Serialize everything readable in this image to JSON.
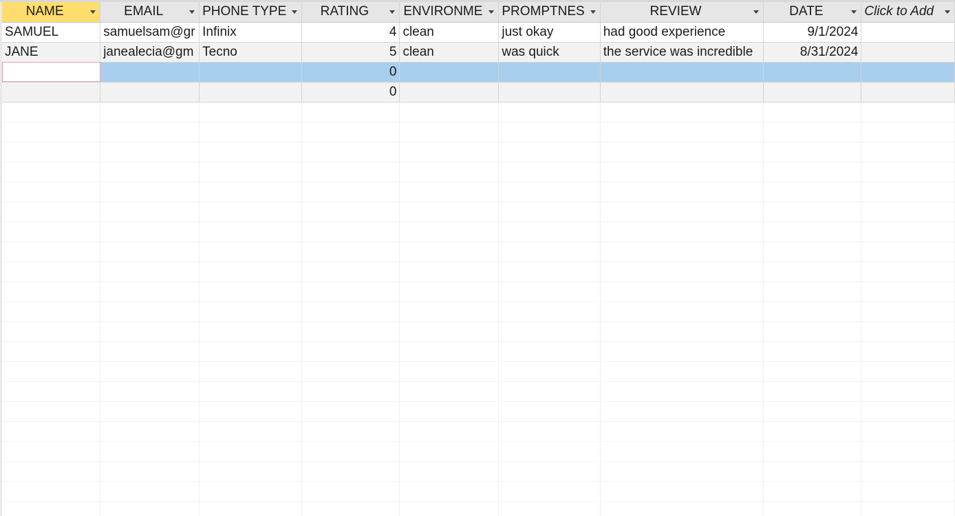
{
  "columns": [
    {
      "label": "NAME"
    },
    {
      "label": "EMAIL"
    },
    {
      "label": "PHONE TYPE"
    },
    {
      "label": "RATING"
    },
    {
      "label": "ENVIRONME"
    },
    {
      "label": "PROMPTNES"
    },
    {
      "label": "REVIEW"
    },
    {
      "label": "DATE"
    },
    {
      "label": "Click to Add"
    }
  ],
  "rows": [
    {
      "name": "SAMUEL",
      "email": "samuelsam@gr",
      "phone_type": "Infinix",
      "rating": "4",
      "environment": "clean",
      "promptness": "just okay",
      "review": "had good experience",
      "date": "9/1/2024",
      "extra": ""
    },
    {
      "name": "JANE",
      "email": "janealecia@gm",
      "phone_type": "Tecno",
      "rating": "5",
      "environment": "clean",
      "promptness": "was quick",
      "review": "the service was incredible",
      "date": "8/31/2024",
      "extra": ""
    }
  ],
  "new_row": {
    "rating": "0"
  },
  "blank_row": {
    "rating": "0"
  },
  "colors": {
    "active_header": "#fddd6e",
    "selected_row": "#a8cfee",
    "header_bg": "#e6e6e6"
  }
}
